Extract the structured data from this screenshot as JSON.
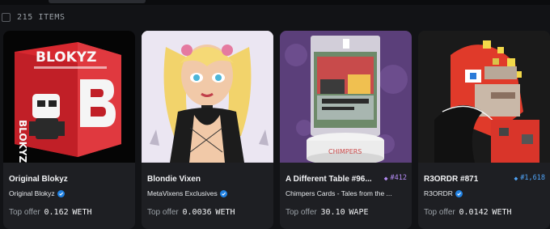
{
  "header": {
    "items_count": "215 ITEMS"
  },
  "offer_label": "Top offer",
  "cards": [
    {
      "name": "Original Blokyz",
      "collection": "Original Blokyz",
      "offer_value": "0.162",
      "currency": "WETH",
      "rank": "",
      "image": "blokyz-box-artwork"
    },
    {
      "name": "Blondie Vixen",
      "collection": "MetaVixens Exclusives",
      "offer_value": "0.0036",
      "currency": "WETH",
      "rank": "",
      "image": "blonde-cartoon-character-artwork"
    },
    {
      "name": "A Different Table #96...",
      "collection": "Chimpers Cards - Tales from the ...",
      "offer_value": "30.10",
      "currency": "WAPE",
      "rank": "#412",
      "image": "chimpers-card-on-pedestal"
    },
    {
      "name": "R3ORDR #871",
      "collection": "R3ORDR",
      "offer_value": "0.0142",
      "currency": "WETH",
      "rank": "#1,618",
      "image": "glitch-portrait-artwork"
    }
  ],
  "colors": {
    "rank_purple": "#b58cf5",
    "rank_blue": "#4fa3f7",
    "verified": "#2081e2"
  },
  "icons": [
    "checkbox",
    "verified-badge-icon",
    "rank-diamond-icon"
  ]
}
